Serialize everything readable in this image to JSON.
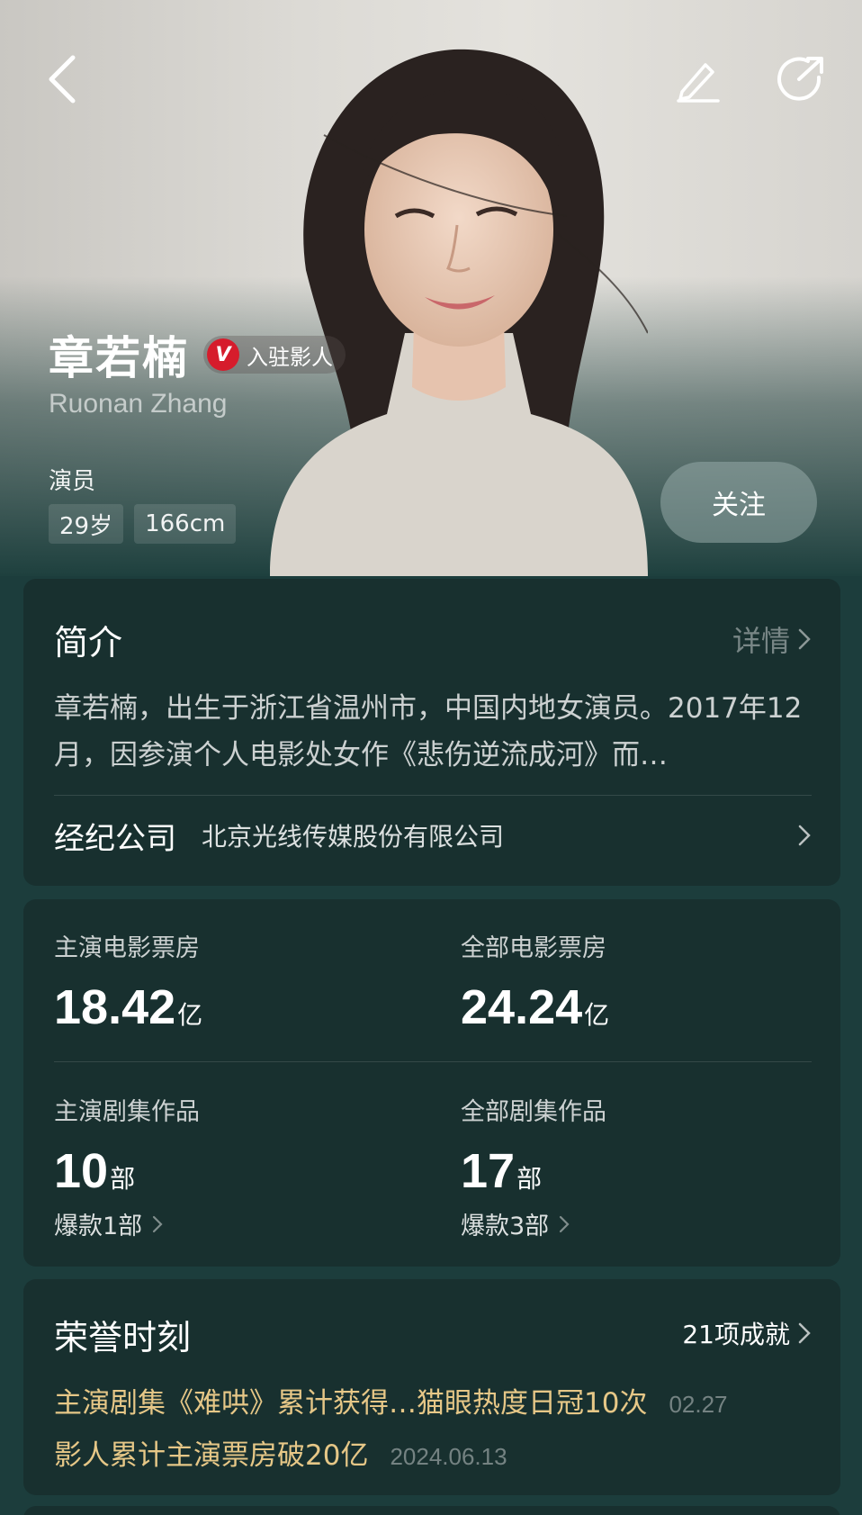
{
  "header": {
    "back_icon": "back-arrow-icon",
    "edit_icon": "pencil-icon",
    "share_icon": "share-icon"
  },
  "profile": {
    "name": "章若楠",
    "badge_letter": "V",
    "badge_text": "入驻影人",
    "name_en": "Ruonan Zhang",
    "role": "演员",
    "tags": [
      "29岁",
      "166cm"
    ],
    "follow_label": "关注"
  },
  "intro": {
    "title": "简介",
    "detail_label": "详情",
    "text": "章若楠，出生于浙江省温州市，中国内地女演员。2017年12月，因参演个人电影处女作《悲伤逆流成河》而…",
    "agency_label": "经纪公司",
    "agency_value": "北京光线传媒股份有限公司"
  },
  "stats": {
    "lead_box_office": {
      "label": "主演电影票房",
      "value": "18.42",
      "unit": "亿"
    },
    "total_box_office": {
      "label": "全部电影票房",
      "value": "24.24",
      "unit": "亿"
    },
    "lead_series": {
      "label": "主演剧集作品",
      "value": "10",
      "unit": "部",
      "sub": "爆款1部"
    },
    "total_series": {
      "label": "全部剧集作品",
      "value": "17",
      "unit": "部",
      "sub": "爆款3部"
    }
  },
  "honors": {
    "title": "荣誉时刻",
    "count_label": "21项成就",
    "items": [
      {
        "text": "主演剧集《难哄》累计获得…猫眼热度日冠10次",
        "date": "02.27"
      },
      {
        "text": "影人累计主演票房破20亿",
        "date": "2024.06.13"
      }
    ]
  },
  "colors": {
    "background": "#1c3d3c",
    "card": "#18302f",
    "honor_text": "#e6c787",
    "badge_red": "#d61c2c"
  }
}
